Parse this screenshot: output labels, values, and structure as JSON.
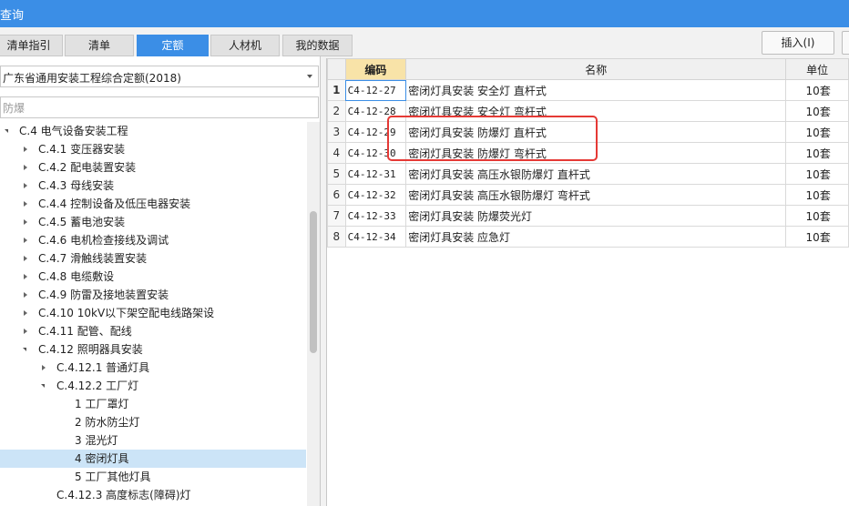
{
  "title": "查询",
  "tabs": [
    {
      "label": "清单指引"
    },
    {
      "label": "清单"
    },
    {
      "label": "定额"
    },
    {
      "label": "人材机"
    },
    {
      "label": "我的数据"
    }
  ],
  "toolbar": {
    "insert_label": "插入(I)"
  },
  "selector": {
    "value": "广东省通用安装工程综合定额(2018)"
  },
  "search": {
    "value": "防爆"
  },
  "tree": [
    {
      "label": "C.4 电气设备安装工程"
    },
    {
      "label": "C.4.1 变压器安装"
    },
    {
      "label": "C.4.2 配电装置安装"
    },
    {
      "label": "C.4.3 母线安装"
    },
    {
      "label": "C.4.4 控制设备及低压电器安装"
    },
    {
      "label": "C.4.5 蓄电池安装"
    },
    {
      "label": "C.4.6 电机检查接线及调试"
    },
    {
      "label": "C.4.7 滑触线装置安装"
    },
    {
      "label": "C.4.8 电缆敷设"
    },
    {
      "label": "C.4.9 防雷及接地装置安装"
    },
    {
      "label": "C.4.10 10kV以下架空配电线路架设"
    },
    {
      "label": "C.4.11 配管、配线"
    },
    {
      "label": "C.4.12 照明器具安装"
    },
    {
      "label": "C.4.12.1 普通灯具"
    },
    {
      "label": "C.4.12.2 工厂灯"
    },
    {
      "label": "1 工厂罩灯"
    },
    {
      "label": "2 防水防尘灯"
    },
    {
      "label": "3 混光灯"
    },
    {
      "label": "4 密闭灯具"
    },
    {
      "label": "5 工厂其他灯具"
    },
    {
      "label": "C.4.12.3 高度标志(障碍)灯"
    }
  ],
  "table": {
    "headers": {
      "code": "编码",
      "name": "名称",
      "unit": "单位"
    },
    "rows": [
      {
        "n": "1",
        "code": "C4-12-27",
        "name": "密闭灯具安装 安全灯 直杆式",
        "unit": "10套"
      },
      {
        "n": "2",
        "code": "C4-12-28",
        "name": "密闭灯具安装 安全灯 弯杆式",
        "unit": "10套"
      },
      {
        "n": "3",
        "code": "C4-12-29",
        "name": "密闭灯具安装 防爆灯 直杆式",
        "unit": "10套"
      },
      {
        "n": "4",
        "code": "C4-12-30",
        "name": "密闭灯具安装 防爆灯 弯杆式",
        "unit": "10套"
      },
      {
        "n": "5",
        "code": "C4-12-31",
        "name": "密闭灯具安装 高压水银防爆灯 直杆式",
        "unit": "10套"
      },
      {
        "n": "6",
        "code": "C4-12-32",
        "name": "密闭灯具安装 高压水银防爆灯 弯杆式",
        "unit": "10套"
      },
      {
        "n": "7",
        "code": "C4-12-33",
        "name": "密闭灯具安装 防爆荧光灯",
        "unit": "10套"
      },
      {
        "n": "8",
        "code": "C4-12-34",
        "name": "密闭灯具安装 应急灯",
        "unit": "10套"
      }
    ]
  }
}
